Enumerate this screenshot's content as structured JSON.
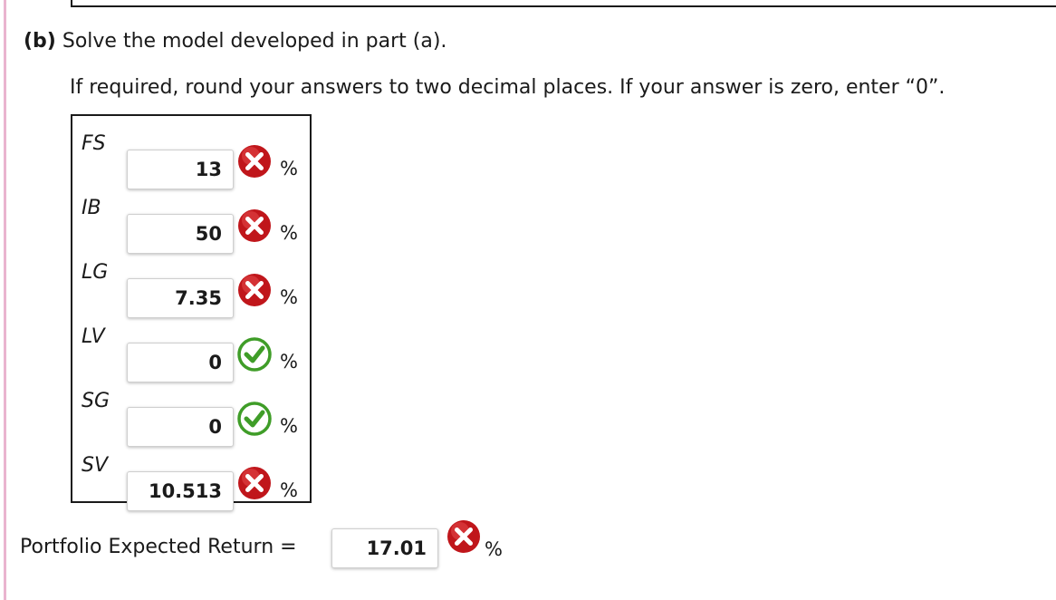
{
  "part": {
    "label": "(b)",
    "text": "Solve the model developed in part (a)."
  },
  "instruction": "If required, round your answers to two decimal places. If your answer is zero, enter “0”.",
  "answers": [
    {
      "label": "FS",
      "value": "13",
      "status": "incorrect",
      "unit": "%"
    },
    {
      "label": "IB",
      "value": "50",
      "status": "incorrect",
      "unit": "%"
    },
    {
      "label": "LG",
      "value": "7.35",
      "status": "incorrect",
      "unit": "%"
    },
    {
      "label": "LV",
      "value": "0",
      "status": "correct",
      "unit": "%"
    },
    {
      "label": "SG",
      "value": "0",
      "status": "correct",
      "unit": "%"
    },
    {
      "label": "SV",
      "value": "10.513",
      "status": "incorrect",
      "unit": "%"
    }
  ],
  "portfolio": {
    "label": "Portfolio Expected Return =",
    "value": "17.01",
    "status": "incorrect",
    "unit": "%"
  },
  "icons": {
    "incorrect": "x-circle-icon",
    "correct": "check-circle-icon"
  },
  "colors": {
    "incorrect": "#c0161b",
    "correct": "#3f9d28",
    "left_accent": "#e9b4cf"
  }
}
